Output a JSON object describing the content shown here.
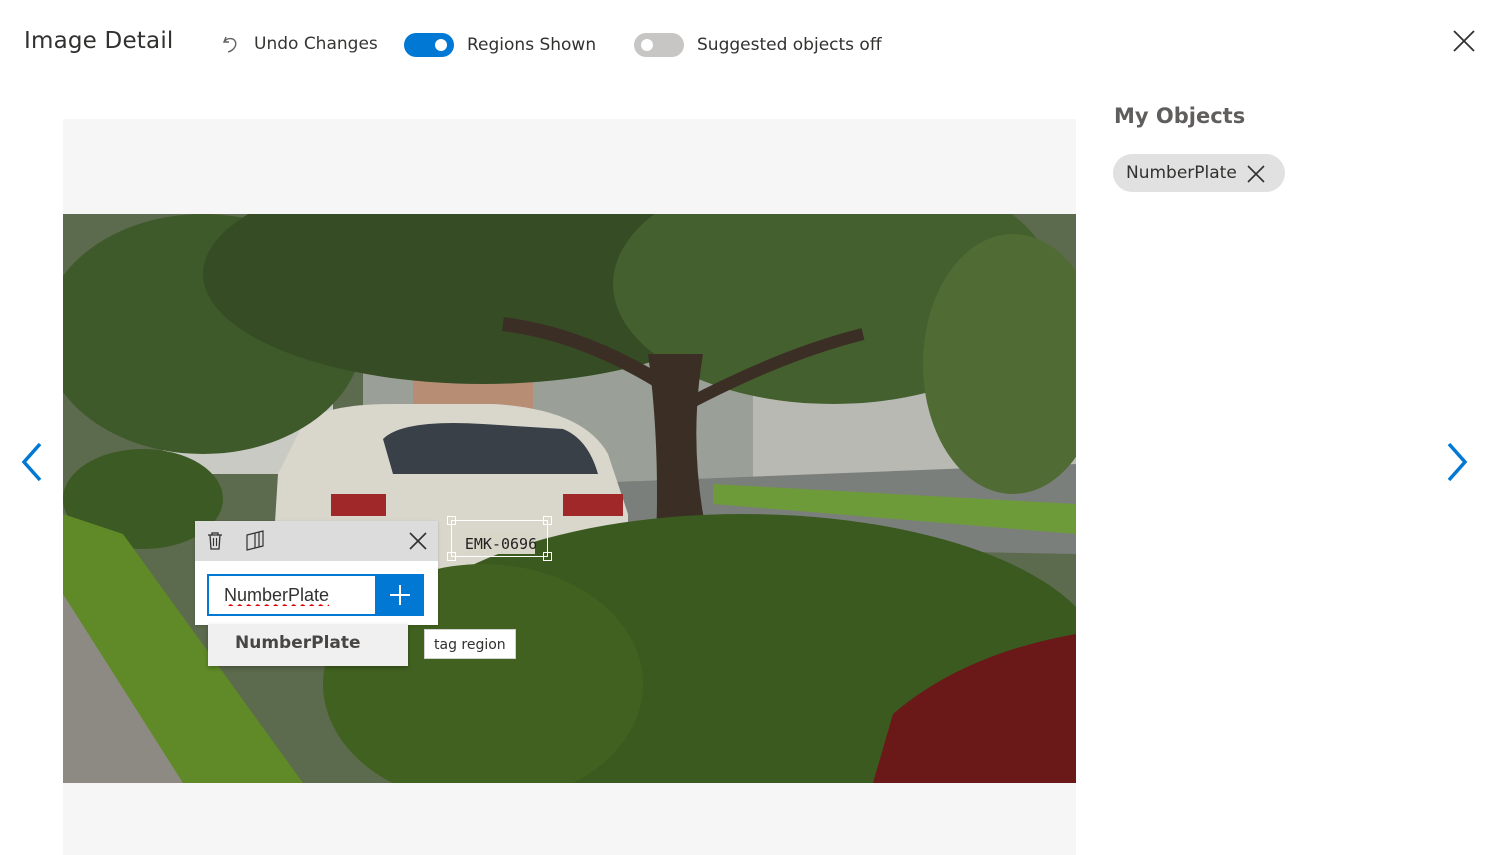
{
  "header": {
    "title": "Image Detail",
    "undo_label": "Undo Changes",
    "regions_toggle": {
      "label": "Regions Shown",
      "on": true
    },
    "suggested_toggle": {
      "label": "Suggested objects off",
      "on": false
    }
  },
  "image": {
    "region": {
      "plate_text": "EMK-0696"
    }
  },
  "region_popup": {
    "tag_input_value": "NumberPlate",
    "suggestion": "NumberPlate",
    "tooltip": "tag region"
  },
  "objects_panel": {
    "title": "My Objects",
    "tags": [
      {
        "label": "NumberPlate"
      }
    ]
  },
  "colors": {
    "accent": "#0078d4",
    "toggle_off": "#c8c6c4",
    "chip_bg": "#e1e1e1"
  },
  "icons": [
    "undo-icon",
    "close-icon",
    "chevron-left-icon",
    "chevron-right-icon",
    "delete-icon",
    "copy-region-icon",
    "plus-icon",
    "remove-tag-icon"
  ]
}
